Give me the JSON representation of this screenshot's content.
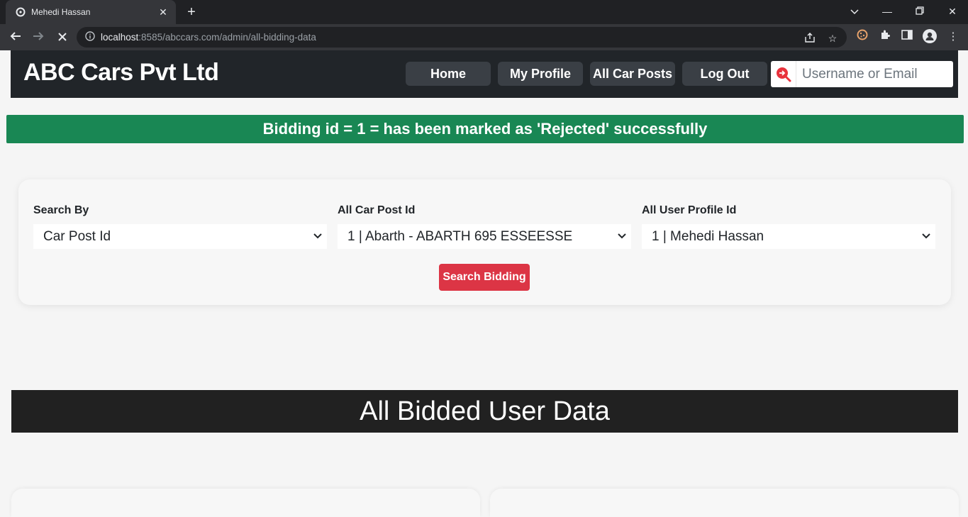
{
  "browser": {
    "tab_title": "Mehedi Hassan",
    "url_host": "localhost",
    "url_rest": ":8585/abccars.com/admin/all-bidding-data"
  },
  "navbar": {
    "brand": "ABC Cars Pvt Ltd",
    "home": "Home",
    "my_profile": "My Profile",
    "all_car_posts": "All Car Posts",
    "log_out": "Log Out",
    "search_placeholder": "Username or Email"
  },
  "alert": {
    "message": "Bidding id = 1 = has been marked as 'Rejected' successfully"
  },
  "search_form": {
    "search_by_label": "Search By",
    "search_by_value": "Car Post Id",
    "car_post_label": "All Car Post Id",
    "car_post_value": "1 | Abarth - ABARTH 695 ESSEESSE",
    "user_profile_label": "All User Profile Id",
    "user_profile_value": "1 | Mehedi Hassan",
    "submit_label": "Search Bidding"
  },
  "section": {
    "title": "All Bidded User Data"
  },
  "colors": {
    "navbar_bg": "#212529",
    "alert_bg": "#198754",
    "danger": "#dc3545"
  }
}
